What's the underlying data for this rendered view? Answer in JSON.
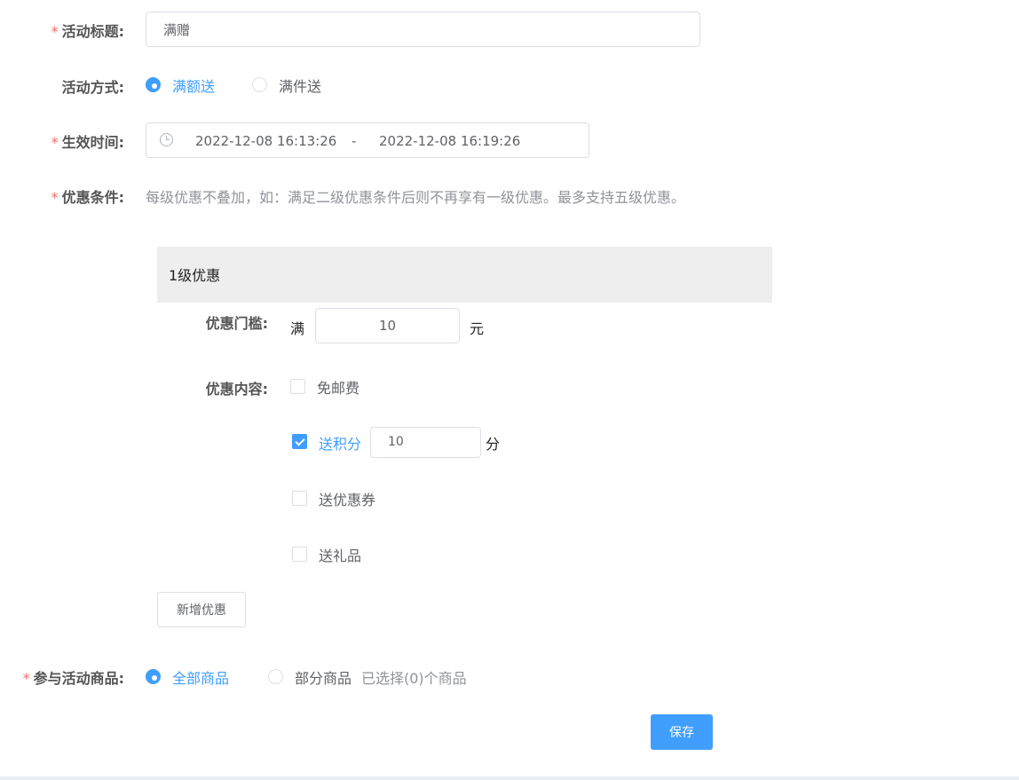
{
  "form": {
    "title": {
      "label": "活动标题:",
      "required": "*",
      "value": "满赠"
    },
    "method": {
      "label": "活动方式:",
      "options": [
        "满额送",
        "满件送"
      ],
      "selected": 0
    },
    "time": {
      "label": "生效时间:",
      "required": "*",
      "start": "2022-12-08 16:13:26",
      "separator": "-",
      "end": "2022-12-08 16:19:26"
    },
    "condition": {
      "label": "优惠条件:",
      "required": "*",
      "hint": "每级优惠不叠加，如：满足二级优惠条件后则不再享有一级优惠。最多支持五级优惠。"
    },
    "tier": {
      "title": "1级优惠",
      "threshold_label": "优惠门槛:",
      "threshold_prefix": "满",
      "threshold_value": "10",
      "threshold_suffix": "元",
      "content_label": "优惠内容:",
      "options": [
        {
          "label": "免邮费",
          "checked": false
        },
        {
          "label": "送积分",
          "checked": true,
          "value": "10",
          "suffix": "分"
        },
        {
          "label": "送优惠券",
          "checked": false
        },
        {
          "label": "送礼品",
          "checked": false
        }
      ]
    },
    "add_tier_button": "新增优惠",
    "products": {
      "label": "参与活动商品:",
      "required": "*",
      "options": [
        "全部商品",
        "部分商品"
      ],
      "selected": 0,
      "selected_note": "已选择(0)个商品"
    },
    "save_button": "保存"
  },
  "colors": {
    "primary": "#409eff",
    "required": "#f56c6c",
    "panel": "#eeeeee"
  }
}
